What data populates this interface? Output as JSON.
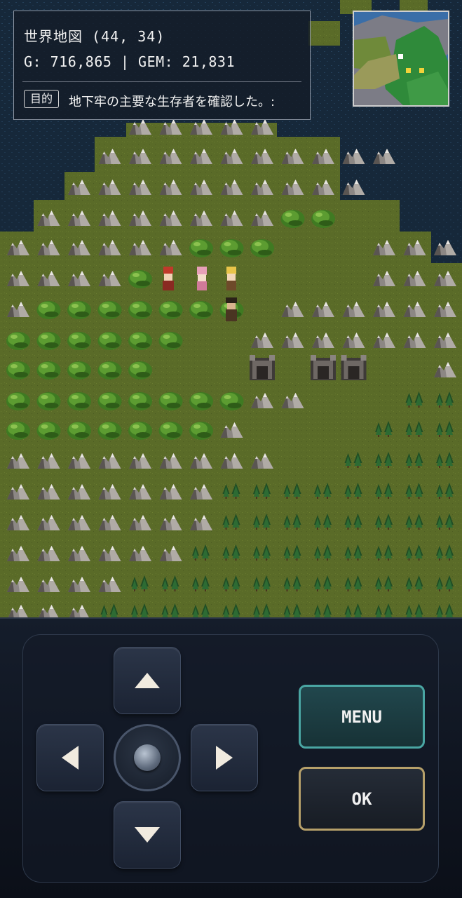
{
  "hud": {
    "location": "世界地図 (44, 34)",
    "currency": "G: 716,865 | GEM: 21,831",
    "objective_tag": "目的",
    "objective_text": "地下牢の主要な生存者を確認した。:"
  },
  "controls": {
    "menu_label": "MENU",
    "ok_label": "OK"
  },
  "colors": {
    "grass": "#5a6b28",
    "water": "#16283a",
    "menu_border": "#4aa6a3",
    "ok_border": "#b6a06a"
  },
  "icons": {
    "up": "arrow-up-icon",
    "down": "arrow-down-icon",
    "left": "arrow-left-icon",
    "right": "arrow-right-icon",
    "center": "joystick-center-icon"
  }
}
